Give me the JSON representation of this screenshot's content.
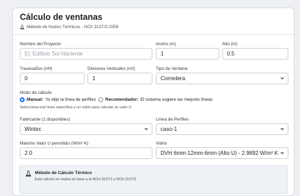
{
  "header": {
    "title": "Cálculo de ventanas",
    "subtitle": "Método de Nudos Térmicos - NCh 3137/2:2008",
    "subtitle_icon": "flask-icon"
  },
  "form": {
    "project_name": {
      "label": "Nombre del Proyecto",
      "placeholder": "Ej: Edificio Sol Naciente",
      "value": ""
    },
    "width": {
      "label": "Ancho (m)",
      "value": "1"
    },
    "height": {
      "label": "Alto (m)",
      "value": "0.5"
    },
    "transoms": {
      "label": "Travesaños (nH)",
      "value": "0"
    },
    "mullions": {
      "label": "Divisores Verticales (nV)",
      "value": "1"
    },
    "window_type": {
      "label": "Tipo de Ventana",
      "value": "Corredera"
    },
    "calc_mode": {
      "label": "Modo de cálculo",
      "manual_bold": "Manual:",
      "manual_text": "Yo elijo la línea de perfiles",
      "recommended_bold": "Recomendador:",
      "recommended_text": "El sistema sugiere las mejores líneas",
      "selected": "manual",
      "help": "Selecciona una línea específica y un vidrio para calcular su valor U."
    },
    "manufacturer": {
      "label": "Fabricante (1 disponibles)",
      "value": "Wintec"
    },
    "profile_line": {
      "label": "Línea de Perfiles",
      "value": "caso-1"
    },
    "max_u": {
      "label": "Máximo Valor U permitido (W/m² K)",
      "value": "2.0"
    },
    "glass": {
      "label": "Vidrio",
      "value": "DVH 6mm-12mm-6mm (Alto U) - 2.9892 W/m² K"
    }
  },
  "info": {
    "title": "Método de Cálculo Térmico",
    "text": "Este cálculo se realiza en base a la NCH 3137/1 y NCH 3137/2",
    "icon": "flask-icon"
  },
  "colors": {
    "accent": "#0d6efd",
    "info_bg": "#eef1f5",
    "page_bg": "#eef0f3"
  }
}
